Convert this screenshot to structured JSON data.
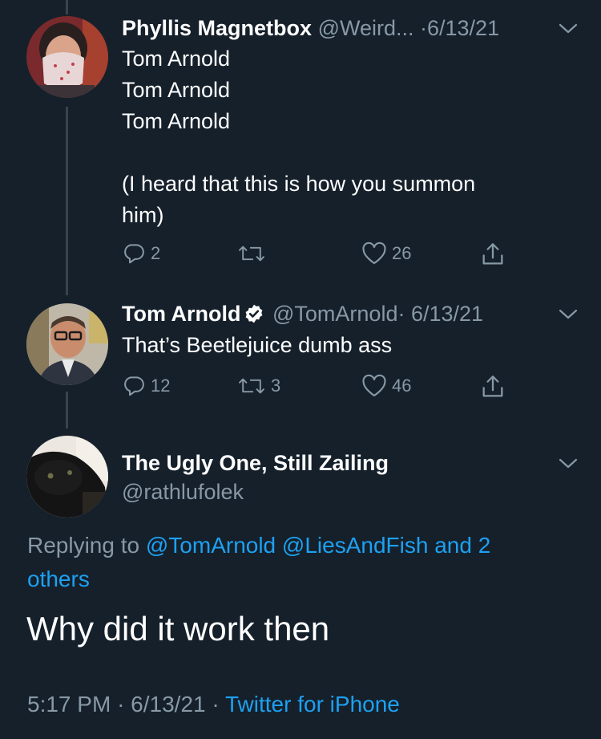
{
  "tweets": [
    {
      "display_name": "Phyllis Magnetbox",
      "handle": "@Weird...",
      "date": "·6/13/21",
      "body": "Tom Arnold\nTom Arnold\nTom Arnold\n\n(I heard that this is how you summon\nhim)",
      "replies": "2",
      "retweets": "",
      "likes": "26"
    },
    {
      "display_name": "Tom Arnold",
      "verified": true,
      "handle": "@TomArnold",
      "date": "· 6/13/21",
      "body": "That’s Beetlejuice dumb ass",
      "replies": "12",
      "retweets": "3",
      "likes": "46"
    }
  ],
  "focused_tweet": {
    "display_name": "The Ugly One, Still Zailing",
    "handle": "@rathlufolek",
    "replying_prefix": "Replying to",
    "replying_mention_1": "@TomArnold",
    "replying_mention_2": "@LiesAndFish",
    "replying_others_line1": "and 2",
    "replying_others_line2": "others",
    "body": "Why did it work then",
    "time": "5:17 PM",
    "date": "· 6/13/21 ·",
    "source": "Twitter for iPhone"
  },
  "colors": {
    "background": "#15202b",
    "muted": "#8899a6",
    "link": "#1da1f2",
    "thread_line": "#38444d"
  },
  "icons": [
    "reply-icon",
    "retweet-icon",
    "like-icon",
    "share-icon",
    "chevron-down-icon",
    "verified-badge-icon"
  ]
}
